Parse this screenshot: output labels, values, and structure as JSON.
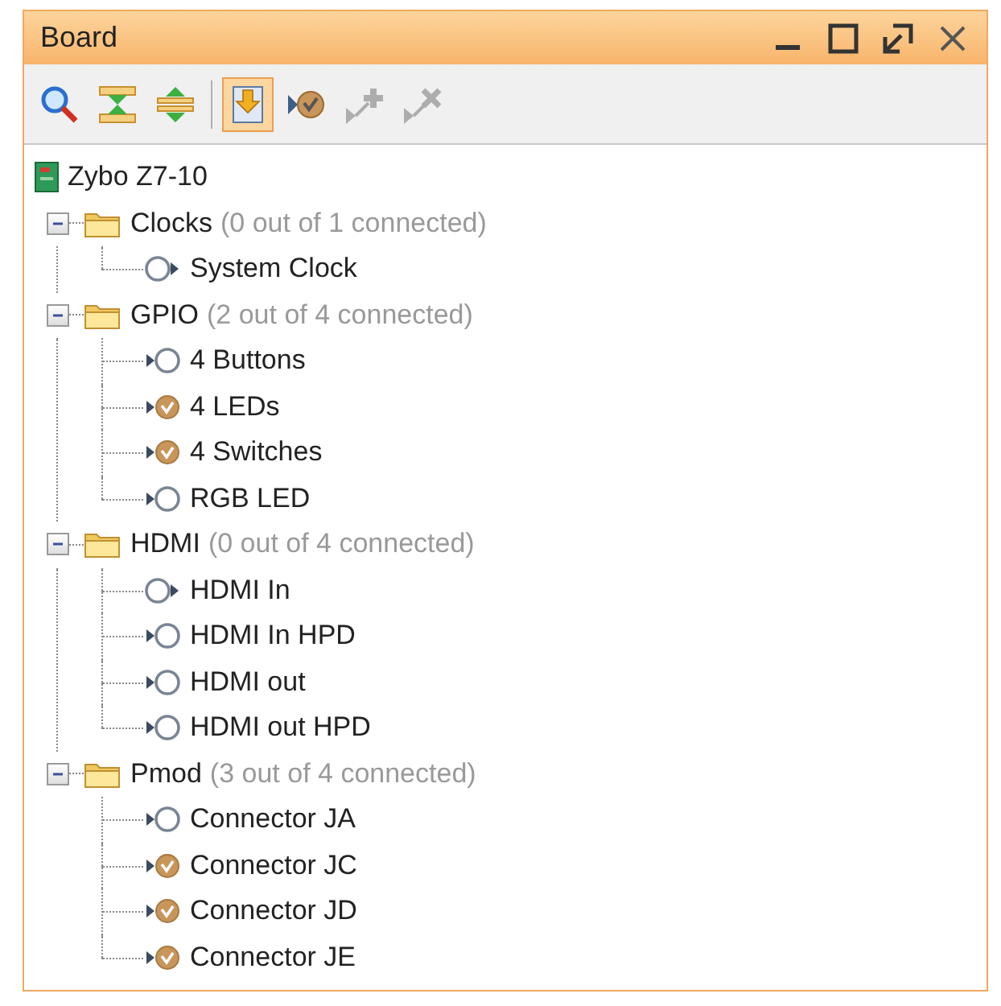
{
  "panel": {
    "title": "Board"
  },
  "window_controls": [
    {
      "kind": "minimize"
    },
    {
      "kind": "maximize"
    },
    {
      "kind": "restore"
    },
    {
      "kind": "close"
    }
  ],
  "toolbar": [
    {
      "kind": "search",
      "selected": false,
      "disabled": false
    },
    {
      "kind": "collapse",
      "selected": false,
      "disabled": false
    },
    {
      "kind": "expand",
      "selected": false,
      "disabled": false
    },
    {
      "kind": "separator"
    },
    {
      "kind": "auto-connect",
      "selected": true,
      "disabled": false
    },
    {
      "kind": "connect",
      "selected": false,
      "disabled": false
    },
    {
      "kind": "add",
      "selected": false,
      "disabled": true
    },
    {
      "kind": "remove",
      "selected": false,
      "disabled": true
    }
  ],
  "tree": {
    "label": "Zybo Z7-10",
    "children": [
      {
        "label": "Clocks",
        "status": "(0 out of 1 connected)",
        "expanded": true,
        "children": [
          {
            "label": "System Clock",
            "kind": "output",
            "connected": false
          }
        ]
      },
      {
        "label": "GPIO",
        "status": "(2 out of 4 connected)",
        "expanded": true,
        "children": [
          {
            "label": "4 Buttons",
            "kind": "input",
            "connected": false
          },
          {
            "label": "4 LEDs",
            "kind": "input",
            "connected": true
          },
          {
            "label": "4 Switches",
            "kind": "input",
            "connected": true
          },
          {
            "label": "RGB LED",
            "kind": "input",
            "connected": false
          }
        ]
      },
      {
        "label": "HDMI",
        "status": "(0 out of 4 connected)",
        "expanded": true,
        "children": [
          {
            "label": "HDMI In",
            "kind": "output",
            "connected": false
          },
          {
            "label": "HDMI In HPD",
            "kind": "input",
            "connected": false
          },
          {
            "label": "HDMI out",
            "kind": "input",
            "connected": false
          },
          {
            "label": "HDMI out HPD",
            "kind": "input",
            "connected": false
          }
        ]
      },
      {
        "label": "Pmod",
        "status": "(3 out of 4 connected)",
        "expanded": true,
        "children": [
          {
            "label": "Connector JA",
            "kind": "input",
            "connected": false
          },
          {
            "label": "Connector JC",
            "kind": "input",
            "connected": true
          },
          {
            "label": "Connector JD",
            "kind": "input",
            "connected": true
          },
          {
            "label": "Connector JE",
            "kind": "input",
            "connected": true
          }
        ]
      }
    ]
  }
}
